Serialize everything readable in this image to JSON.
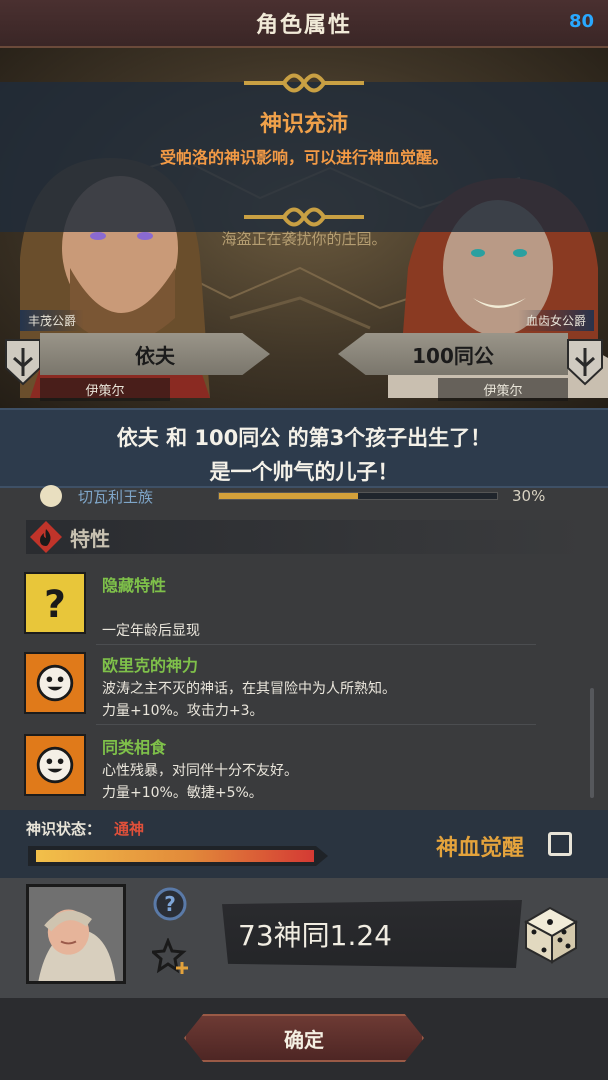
{
  "header": {
    "title": "角色属性",
    "fps": "80"
  },
  "scene": {
    "headline": "神识充沛",
    "subtitle": "受帕洛的神识影响，可以进行神血觉醒。",
    "notice": "海盗正在袭扰你的庄园。",
    "left_noble": {
      "title": "丰茂公爵",
      "name": "依夫",
      "region": "伊策尔"
    },
    "right_noble": {
      "title": "血齿女公爵",
      "name": "100同公",
      "region": "伊策尔"
    }
  },
  "birth": {
    "line1": "依夫 和 100同公 的第3个孩子出生了！",
    "line2": "是一个帅气的儿子！"
  },
  "faction": {
    "name": "切瓦利王族",
    "percent": "30%",
    "fill": 0.5
  },
  "traits_section": {
    "title": "特性",
    "items": [
      {
        "name": "隐藏特性",
        "desc": "",
        "effect": "一定年龄后显现",
        "icon": "question-icon"
      },
      {
        "name": "欧里克的神力",
        "desc": "波涛之主不灭的神话，在其冒险中为人所熟知。",
        "effect": "力量+10%。攻击力+3。",
        "icon": "smiley-icon"
      },
      {
        "name": "同类相食",
        "desc": "心性残暴，对同伴十分不友好。",
        "effect": "力量+10%。敏捷+5%。",
        "icon": "smiley-icon"
      }
    ]
  },
  "status": {
    "label": "神识状态：",
    "value": "通神",
    "progress": 1.0,
    "awaken_label": "神血觉醒",
    "awaken_checked": false
  },
  "child": {
    "name": "73神同1.24"
  },
  "footer": {
    "confirm_label": "确定"
  },
  "colors": {
    "accent_orange": "#f0a14a",
    "trait_green": "#7fc14a",
    "status_red": "#e0503a",
    "fps_blue": "#29a8ff"
  }
}
